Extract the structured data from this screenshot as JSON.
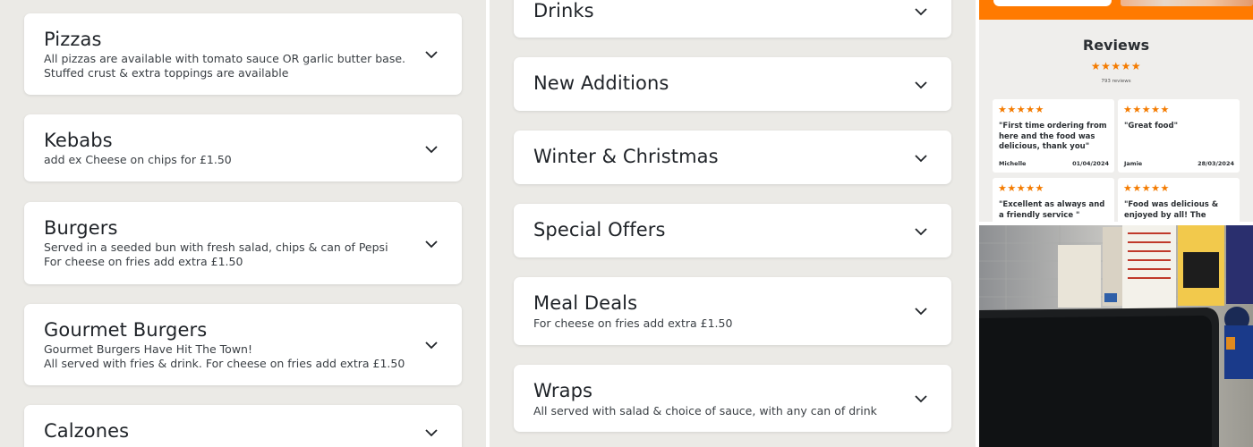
{
  "left_column": {
    "cards": [
      {
        "title": "Pizzas",
        "desc": [
          "All pizzas are available with tomato sauce OR garlic butter base. Stuffed crust & extra toppings are available"
        ]
      },
      {
        "title": "Kebabs",
        "desc": [
          "add ex Cheese on chips for £1.50"
        ]
      },
      {
        "title": "Burgers",
        "desc": [
          "Served in a seeded bun with fresh salad, chips & can of Pepsi",
          "For cheese on fries add extra £1.50"
        ]
      },
      {
        "title": "Gourmet Burgers",
        "desc": [
          "Gourmet Burgers Have Hit The Town!",
          "All served with fries & drink. For cheese on fries add extra £1.50"
        ]
      },
      {
        "title": "Calzones",
        "desc": []
      }
    ]
  },
  "middle_column": {
    "cards": [
      {
        "title": "Drinks",
        "desc": []
      },
      {
        "title": "New Additions",
        "desc": []
      },
      {
        "title": "Winter & Christmas",
        "desc": []
      },
      {
        "title": "Special Offers",
        "desc": []
      },
      {
        "title": "Meal Deals",
        "desc": [
          "For cheese on fries add extra £1.50"
        ]
      },
      {
        "title": "Wraps",
        "desc": [
          "All served with salad & choice of sauce, with any can of drink"
        ]
      }
    ]
  },
  "icons": {
    "expand": "chevron-down-icon",
    "star": "star-icon"
  },
  "colors": {
    "accent": "#ff7a00",
    "star": "#f47b00"
  },
  "reviews": {
    "title": "Reviews",
    "rating_stars": "★★★★★",
    "count_label": "793 reviews",
    "items": [
      {
        "stars": "★★★★★",
        "text": "\"First time ordering from here and the food was delicious, thank you\"",
        "name": "Michelle",
        "date": "01/04/2024"
      },
      {
        "stars": "★★★★★",
        "text": "\"Great food\"",
        "name": "Jamie",
        "date": "28/03/2024"
      },
      {
        "stars": "★★★★★",
        "text": "\"Excellent as always and a friendly service  \"",
        "name": "",
        "date": ""
      },
      {
        "stars": "★★★★★",
        "text": "\"Food was delicious & enjoyed by all! The",
        "name": "",
        "date": ""
      }
    ]
  }
}
